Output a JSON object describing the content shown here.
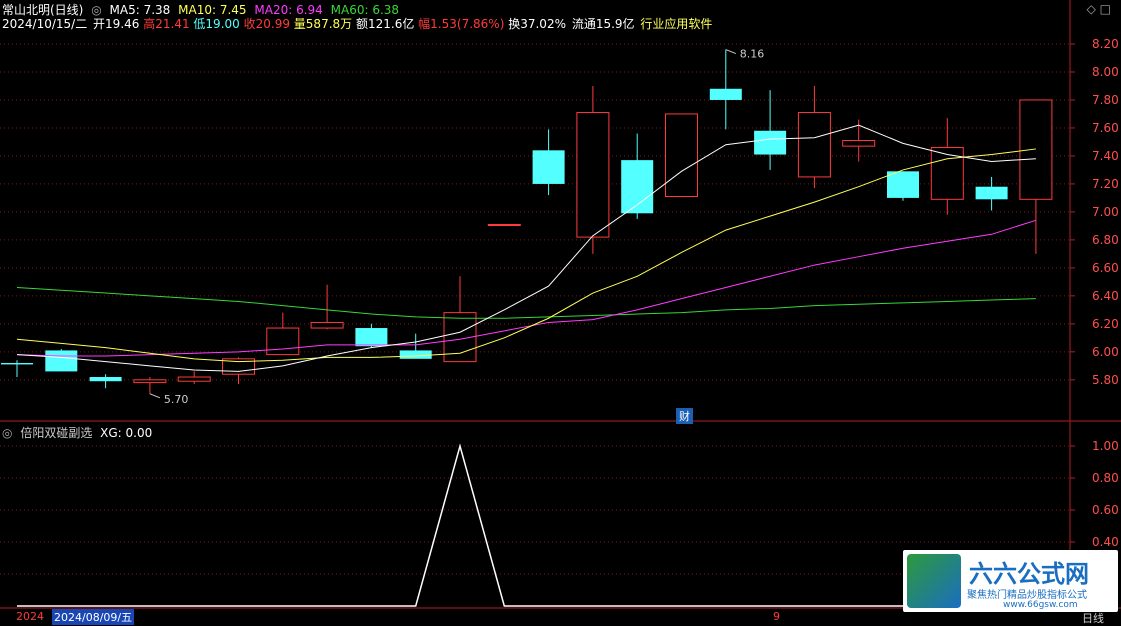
{
  "header": {
    "stock_name": "常山北明(日线)",
    "ma5": "MA5: 7.38",
    "ma10": "MA10: 7.45",
    "ma20": "MA20: 6.94",
    "ma60": "MA60: 6.38",
    "date": "2024/10/15/二",
    "open": "开19.46",
    "high": "高21.41",
    "low": "低19.00",
    "close": "收20.99",
    "volume": "量587.8万",
    "amount": "额121.6亿",
    "change": "幅1.53(7.86%)",
    "turnover": "换37.02%",
    "float": "流通15.9亿",
    "industry": "行业应用软件"
  },
  "indicator": {
    "name": "倍阳双碰副选",
    "value": "XG: 0.00"
  },
  "annotations": {
    "high_label": "8.16",
    "low_label": "5.70",
    "finance_badge": "财"
  },
  "footer": {
    "year_prefix": "2024",
    "cursor_date": "2024/08/09/五",
    "month_mark": "9",
    "period": "日线"
  },
  "logo": {
    "title": "六六公式网",
    "subtitle": "聚焦热门精品炒股指标公式",
    "url": "www.66gsw.com"
  },
  "colors": {
    "up": "#ff3b3b",
    "down": "#54ffff",
    "ma5": "#ffffff",
    "ma10": "#ffff5a",
    "ma20": "#ff3cff",
    "ma60": "#39d639",
    "axis": "#b02020"
  },
  "chart_data": [
    {
      "type": "candlestick",
      "y_ticks": [
        5.8,
        6.0,
        6.2,
        6.4,
        6.6,
        6.8,
        7.0,
        7.2,
        7.4,
        7.6,
        7.8,
        8.0,
        8.2
      ],
      "ylim": [
        5.62,
        8.3
      ],
      "candles": [
        {
          "o": 5.92,
          "h": 5.94,
          "l": 5.82,
          "c": 5.91
        },
        {
          "o": 6.01,
          "h": 6.02,
          "l": 5.86,
          "c": 5.86
        },
        {
          "o": 5.82,
          "h": 5.84,
          "l": 5.74,
          "c": 5.79
        },
        {
          "o": 5.78,
          "h": 5.82,
          "l": 5.7,
          "c": 5.8
        },
        {
          "o": 5.79,
          "h": 5.86,
          "l": 5.77,
          "c": 5.82
        },
        {
          "o": 5.84,
          "h": 5.96,
          "l": 5.77,
          "c": 5.95
        },
        {
          "o": 5.98,
          "h": 6.28,
          "l": 5.98,
          "c": 6.17
        },
        {
          "o": 6.17,
          "h": 6.48,
          "l": 6.16,
          "c": 6.21
        },
        {
          "o": 6.17,
          "h": 6.2,
          "l": 6.03,
          "c": 6.04
        },
        {
          "o": 6.01,
          "h": 6.13,
          "l": 5.97,
          "c": 5.95
        },
        {
          "o": 5.93,
          "h": 6.54,
          "l": 5.93,
          "c": 6.28
        },
        {
          "o": 6.91,
          "h": 6.91,
          "l": 6.91,
          "c": 6.91
        },
        {
          "o": 7.44,
          "h": 7.59,
          "l": 7.12,
          "c": 7.2
        },
        {
          "o": 6.82,
          "h": 7.9,
          "l": 6.7,
          "c": 7.71
        },
        {
          "o": 7.37,
          "h": 7.56,
          "l": 6.95,
          "c": 6.99
        },
        {
          "o": 7.11,
          "h": 7.7,
          "l": 7.11,
          "c": 7.7
        },
        {
          "o": 7.88,
          "h": 8.16,
          "l": 7.59,
          "c": 7.8
        },
        {
          "o": 7.58,
          "h": 7.87,
          "l": 7.3,
          "c": 7.41
        },
        {
          "o": 7.25,
          "h": 7.9,
          "l": 7.17,
          "c": 7.71
        },
        {
          "o": 7.47,
          "h": 7.66,
          "l": 7.36,
          "c": 7.51
        },
        {
          "o": 7.29,
          "h": 7.29,
          "l": 7.08,
          "c": 7.1
        },
        {
          "o": 7.09,
          "h": 7.67,
          "l": 6.98,
          "c": 7.46
        },
        {
          "o": 7.18,
          "h": 7.25,
          "l": 7.01,
          "c": 7.09
        },
        {
          "o": 7.09,
          "h": 7.8,
          "l": 6.7,
          "c": 7.8
        }
      ],
      "ma5": [
        5.98,
        5.96,
        5.93,
        5.9,
        5.87,
        5.86,
        5.9,
        5.97,
        6.03,
        6.07,
        6.14,
        6.3,
        6.47,
        6.83,
        7.05,
        7.29,
        7.48,
        7.52,
        7.53,
        7.62,
        7.49,
        7.41,
        7.36,
        7.38
      ],
      "ma10": [
        6.09,
        6.06,
        6.03,
        5.99,
        5.95,
        5.93,
        5.94,
        5.96,
        5.96,
        5.97,
        5.99,
        6.1,
        6.24,
        6.42,
        6.54,
        6.71,
        6.87,
        6.97,
        7.07,
        7.18,
        7.3,
        7.38,
        7.41,
        7.45
      ],
      "ma20": [
        5.98,
        5.97,
        5.97,
        5.98,
        5.99,
        6.0,
        6.02,
        6.05,
        6.05,
        6.05,
        6.09,
        6.15,
        6.21,
        6.23,
        6.3,
        6.38,
        6.46,
        6.54,
        6.62,
        6.68,
        6.74,
        6.79,
        6.84,
        6.94
      ],
      "ma60": [
        6.46,
        6.44,
        6.42,
        6.4,
        6.38,
        6.36,
        6.33,
        6.3,
        6.27,
        6.25,
        6.24,
        6.24,
        6.25,
        6.26,
        6.27,
        6.28,
        6.3,
        6.31,
        6.33,
        6.34,
        6.35,
        6.36,
        6.37,
        6.38
      ]
    },
    {
      "type": "line",
      "series": [
        {
          "name": "XG",
          "values": [
            0,
            0,
            0,
            0,
            0,
            0,
            0,
            0,
            0,
            0,
            1,
            0,
            0,
            0,
            0,
            0,
            0,
            0,
            0,
            0,
            0,
            0,
            0,
            0
          ]
        }
      ],
      "y_ticks": [
        0.2,
        0.4,
        0.6,
        0.8,
        1.0
      ],
      "ylim": [
        0,
        1.1
      ]
    }
  ]
}
